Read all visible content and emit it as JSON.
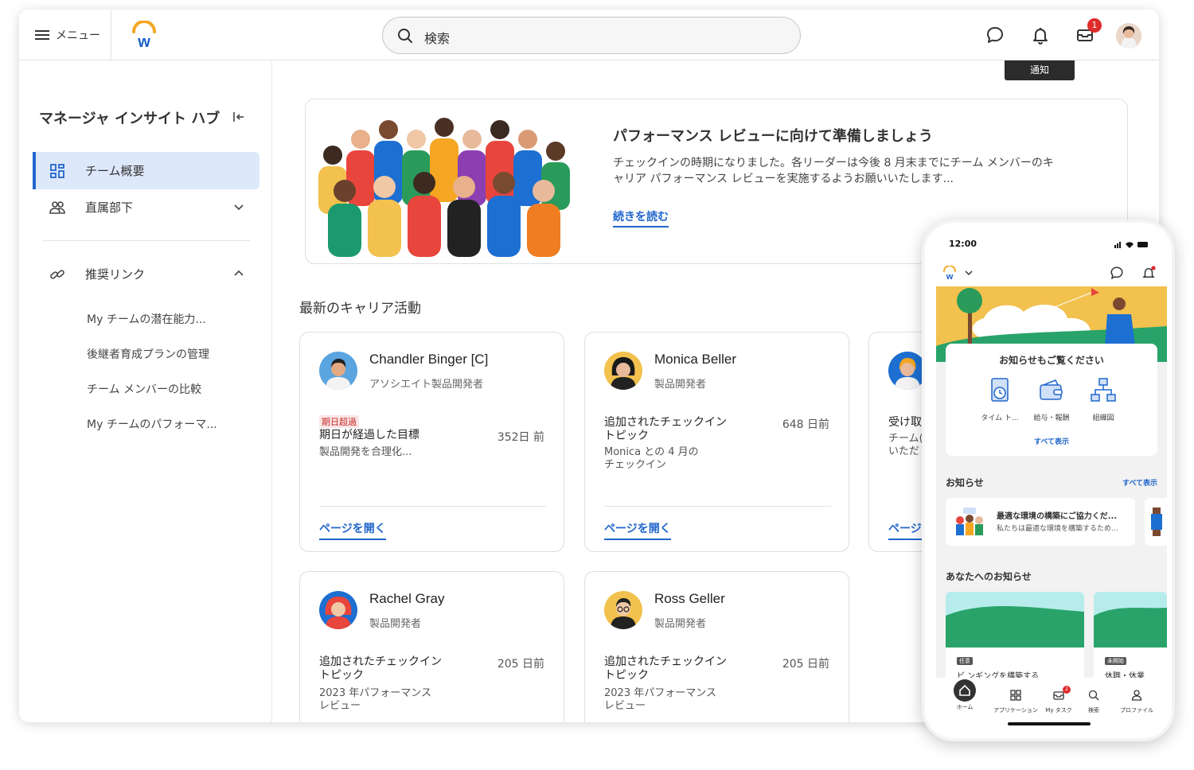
{
  "topbar": {
    "menu_label": "メニュー",
    "search_placeholder": "検索",
    "inbox_badge": "1",
    "tooltip": "通知"
  },
  "sidebar": {
    "title": "マネージャ インサイト ハブ",
    "items": [
      {
        "label": "チーム概要",
        "icon": "grid-icon",
        "active": true
      },
      {
        "label": "直属部下",
        "icon": "people-icon"
      }
    ],
    "links_title": "推奨リンク",
    "links": [
      "My チームの潜在能力...",
      "後継者育成プランの管理",
      "チーム メンバーの比較",
      "My チームのパフォーマ..."
    ]
  },
  "banner": {
    "title": "パフォーマンス レビューに向けて準備しましょう",
    "body": "チェックインの時期になりました。各リーダーは今後 8 月末までにチーム メンバーのキャリア パフォーマンス レビューを実施するようお願いいたします...",
    "link": "続きを読む"
  },
  "section_title": "最新のキャリア活動",
  "cards": [
    {
      "name": "Chandler Binger [C]",
      "role": "アソシエイト製品開発者",
      "tag": "期日超過",
      "title": "期日が経過した目標",
      "days": "352日 前",
      "desc": "製品開発を合理化...",
      "link": "ページを開く"
    },
    {
      "name": "Monica Beller",
      "role": "製品開発者",
      "title": "追加されたチェックイン トピック",
      "days": "648 日前",
      "desc": "Monica との 4 月の チェックイン",
      "link": "ページを開く"
    },
    {
      "name": "Rachel Gray",
      "role": "製品開発者",
      "title": "追加されたチェックイン トピック",
      "days": "205 日前",
      "desc": "2023 年パフォーマンス レビュー"
    },
    {
      "name": "Ross Geller",
      "role": "製品開発者",
      "title": "追加されたチェックイン トピック",
      "days": "205 日前",
      "desc": "2023 年パフォーマンス レビュー"
    },
    {
      "title": "受け取",
      "desc": "チーム( いただ",
      "link": "ページ"
    }
  ],
  "phone": {
    "time": "12:00",
    "card_title": "お知らせもご覧ください",
    "apps": [
      "タイム ト...",
      "給与・報酬",
      "組織図"
    ],
    "view_all": "すべて表示",
    "news_title": "お知らせ",
    "news_view_all": "すべて表示",
    "news_item_title": "最適な環境の構築にご協力くだ...",
    "news_item_desc": "私たちは最適な環境を構築するため...",
    "for_you_title": "あなたへのお知らせ",
    "tiles": [
      {
        "badge": "任意",
        "text": "ビ ンギングを構築する"
      },
      {
        "badge": "未開始",
        "text": "休職・休業"
      }
    ],
    "nav": [
      "ホーム",
      "アプリケーション",
      "My タスク",
      "検索",
      "プロファイル"
    ],
    "task_badge": "2"
  }
}
